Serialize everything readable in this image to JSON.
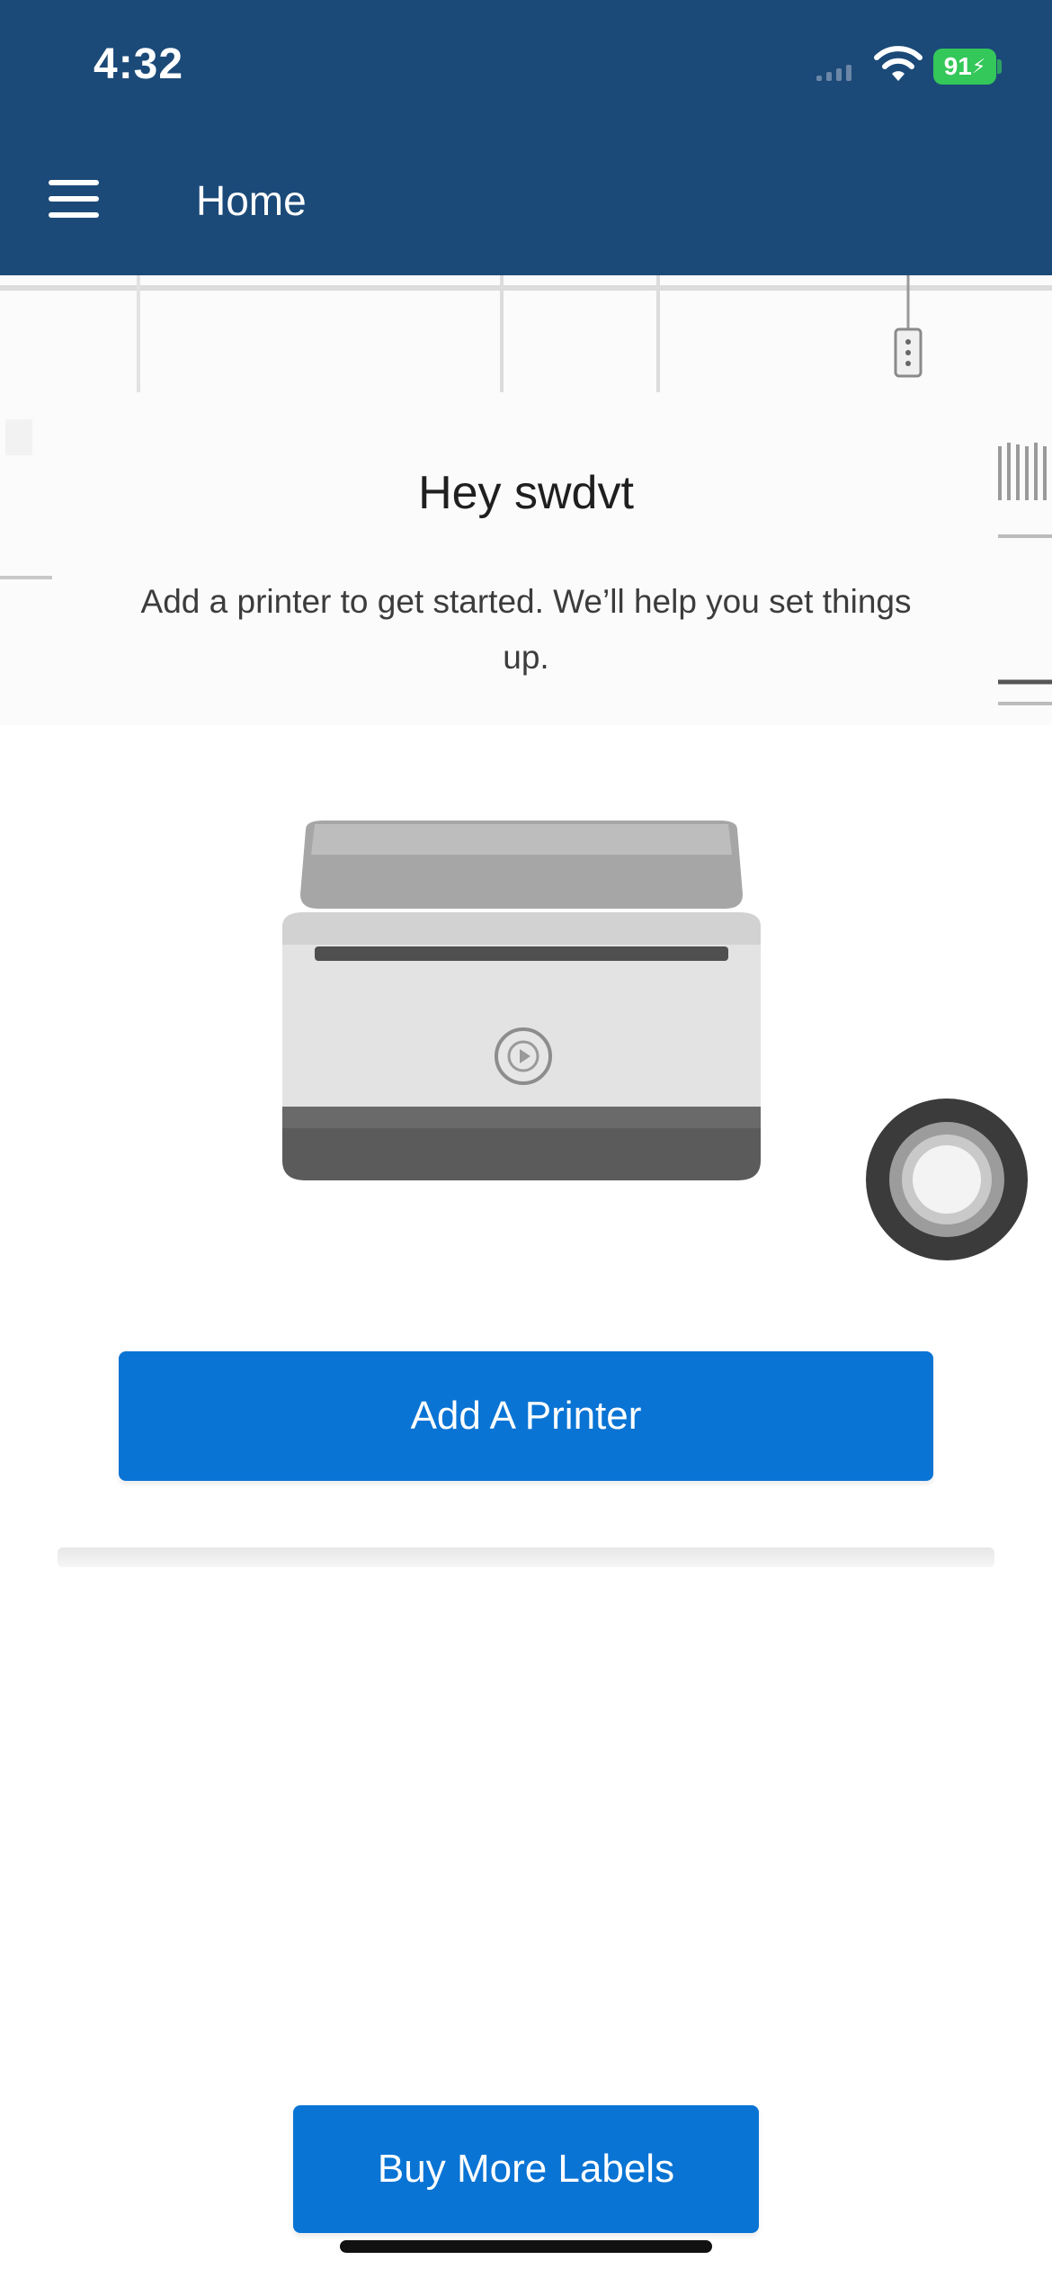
{
  "status_bar": {
    "time": "4:32",
    "battery_level": "91",
    "icons": [
      "signal-icon",
      "wifi-icon",
      "battery-charging-icon"
    ]
  },
  "app_bar": {
    "title": "Home",
    "menu_icon": "hamburger-menu-icon"
  },
  "main": {
    "greeting": "Hey swdvt",
    "subtitle": "Add a printer to get started. We’ll help you set things up.",
    "illustration": "label-printer",
    "add_printer_label": "Add A Printer"
  },
  "footer": {
    "buy_labels_label": "Buy More Labels"
  },
  "colors": {
    "header": "#1b4a78",
    "primary_button": "#0a74d4",
    "battery": "#34c759"
  }
}
